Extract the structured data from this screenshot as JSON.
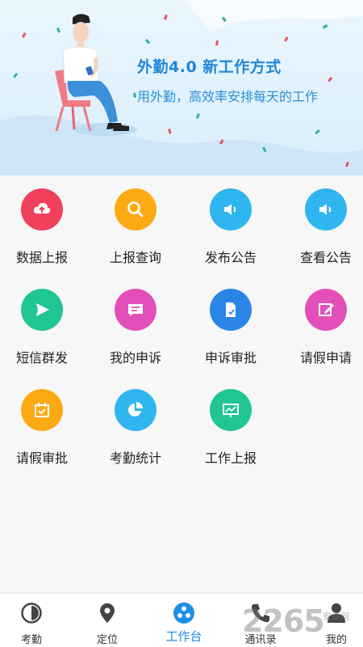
{
  "banner": {
    "title": "外勤4.0  新工作方式",
    "subtitle": "用外勤，高效率安排每天的工作"
  },
  "grid": {
    "items": [
      {
        "label": "数据上报",
        "icon": "cloud-upload-icon",
        "color": "#f0405b"
      },
      {
        "label": "上报查询",
        "icon": "search-icon",
        "color": "#fcaa14"
      },
      {
        "label": "发布公告",
        "icon": "speaker-icon",
        "color": "#2fb5ef"
      },
      {
        "label": "查看公告",
        "icon": "speaker-icon",
        "color": "#2fb5ef"
      },
      {
        "label": "短信群发",
        "icon": "send-icon",
        "color": "#20c593"
      },
      {
        "label": "我的申诉",
        "icon": "message-icon",
        "color": "#e34fb8"
      },
      {
        "label": "申诉审批",
        "icon": "document-check-icon",
        "color": "#2b85e6"
      },
      {
        "label": "请假申请",
        "icon": "edit-icon",
        "color": "#e34fb8"
      },
      {
        "label": "请假审批",
        "icon": "calendar-check-icon",
        "color": "#fcaa14"
      },
      {
        "label": "考勤统计",
        "icon": "pie-chart-icon",
        "color": "#2fb5ef"
      },
      {
        "label": "工作上报",
        "icon": "presentation-icon",
        "color": "#20c593"
      }
    ]
  },
  "tabbar": {
    "tabs": [
      {
        "label": "考勤",
        "icon": "clock-icon"
      },
      {
        "label": "定位",
        "icon": "location-pin-icon"
      },
      {
        "label": "工作台",
        "icon": "workbench-icon",
        "active": true
      },
      {
        "label": "通讯录",
        "icon": "phone-icon"
      },
      {
        "label": "我的",
        "icon": "person-icon"
      }
    ],
    "active_color": "#1c8ee8"
  },
  "watermark": {
    "number": "2265",
    "site": "安卓网"
  }
}
